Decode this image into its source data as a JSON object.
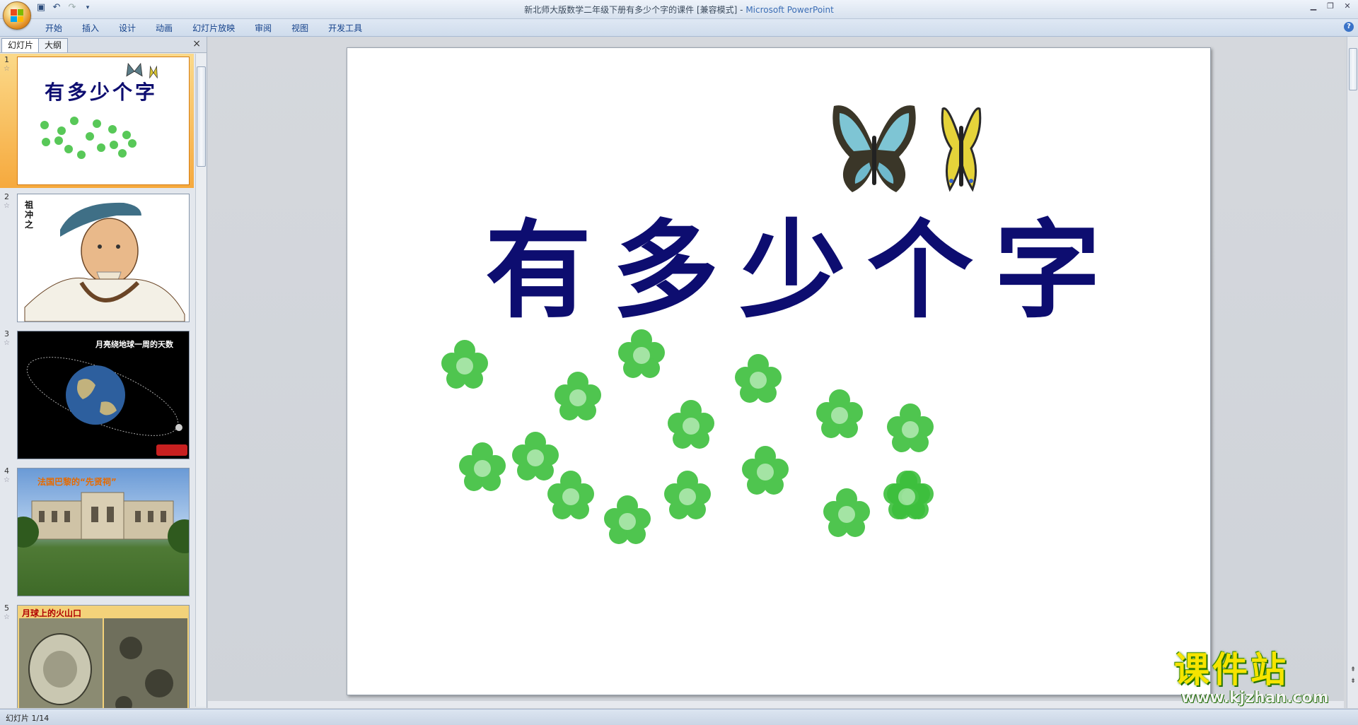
{
  "window": {
    "title_doc": "新北师大版数学二年级下册有多少个字的课件 [兼容模式]",
    "title_sep": " - ",
    "title_app": "Microsoft PowerPoint"
  },
  "quick_access": {
    "icons": [
      "save-icon",
      "undo-icon",
      "redo-icon",
      "dropdown-icon"
    ]
  },
  "ribbon": {
    "tabs": [
      "开始",
      "插入",
      "设计",
      "动画",
      "幻灯片放映",
      "审阅",
      "视图",
      "开发工具"
    ]
  },
  "pane": {
    "tab_slides": "幻灯片",
    "tab_outline": "大纲",
    "close": "×"
  },
  "thumbnails": [
    {
      "number": "1",
      "title": "有多少个字",
      "selected": true
    },
    {
      "number": "2",
      "label": "祖冲之"
    },
    {
      "number": "3",
      "label": "月亮绕地球一周的天数"
    },
    {
      "number": "4",
      "label": "法国巴黎的“先贤祠”"
    },
    {
      "number": "5",
      "label": "月球上的火山口"
    }
  ],
  "slide": {
    "title": "有多少个字"
  },
  "status": {
    "text": "幻灯片 1/14"
  },
  "watermark": {
    "cn": "课件站",
    "url": "www.kjzhan.com"
  },
  "colors": {
    "title": "#0d0d70",
    "clover": "#3cbf3c",
    "selection": "#f6a93d"
  }
}
